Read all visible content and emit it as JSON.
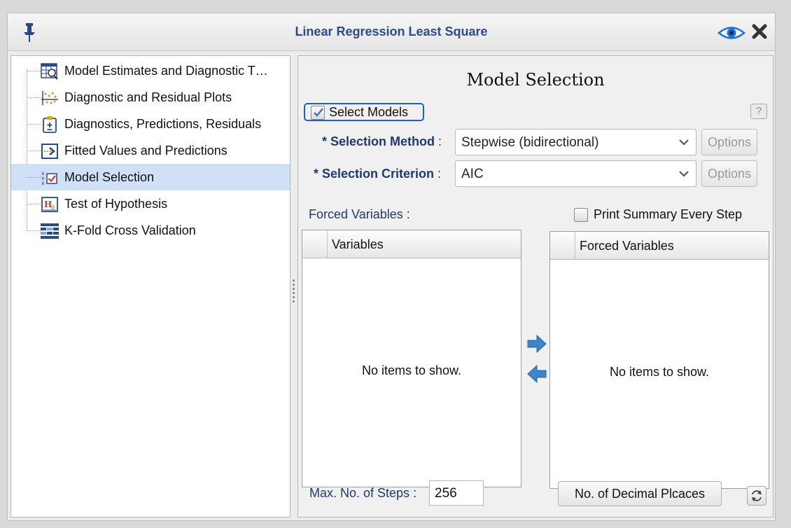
{
  "window": {
    "title": "Linear Regression Least Square"
  },
  "tree": {
    "items": [
      {
        "label": "Model Estimates and Diagnostic T…",
        "icon": "table-magnifier-icon"
      },
      {
        "label": "Diagnostic and Residual Plots",
        "icon": "scatter-plot-icon"
      },
      {
        "label": "Diagnostics, Predictions, Residuals",
        "icon": "clipboard-plusminus-icon"
      },
      {
        "label": "Fitted Values and Predictions",
        "icon": "arrow-box-icon"
      },
      {
        "label": "Model Selection",
        "icon": "model-selection-icon"
      },
      {
        "label": "Test of Hypothesis",
        "icon": "hypothesis-icon"
      },
      {
        "label": "K-Fold Cross Validation",
        "icon": "kfold-grid-icon"
      }
    ],
    "selected_index": 4
  },
  "panel": {
    "title": "Model Selection",
    "select_models": {
      "label": "Select Models",
      "checked": true
    },
    "help_label": "?",
    "selection_method": {
      "label": "* Selection Method",
      "colon": ":",
      "value": "Stepwise (bidirectional)",
      "options_label": "Options"
    },
    "selection_criterion": {
      "label": "* Selection Criterion",
      "colon": ":",
      "value": "AIC",
      "options_label": "Options"
    },
    "forced_variables_label": "Forced Variables",
    "colon": ":",
    "print_summary": {
      "label": "Print Summary Every Step",
      "checked": false
    },
    "variables_list": {
      "header": "Variables",
      "empty_text": "No items to show."
    },
    "forced_list": {
      "header": "Forced Variables",
      "empty_text": "No items to show."
    },
    "max_steps": {
      "label": "Max. No. of Steps",
      "colon": ":",
      "value": "256"
    },
    "decimal_button_label": "No. of Decimal Plcaces"
  },
  "colors": {
    "accent": "#1d5fc5",
    "label_blue": "#1f3a6b",
    "title_blue": "#2f4a8a",
    "selected_row": "#cfe0f7",
    "arrow_blue": "#3b87c9"
  }
}
